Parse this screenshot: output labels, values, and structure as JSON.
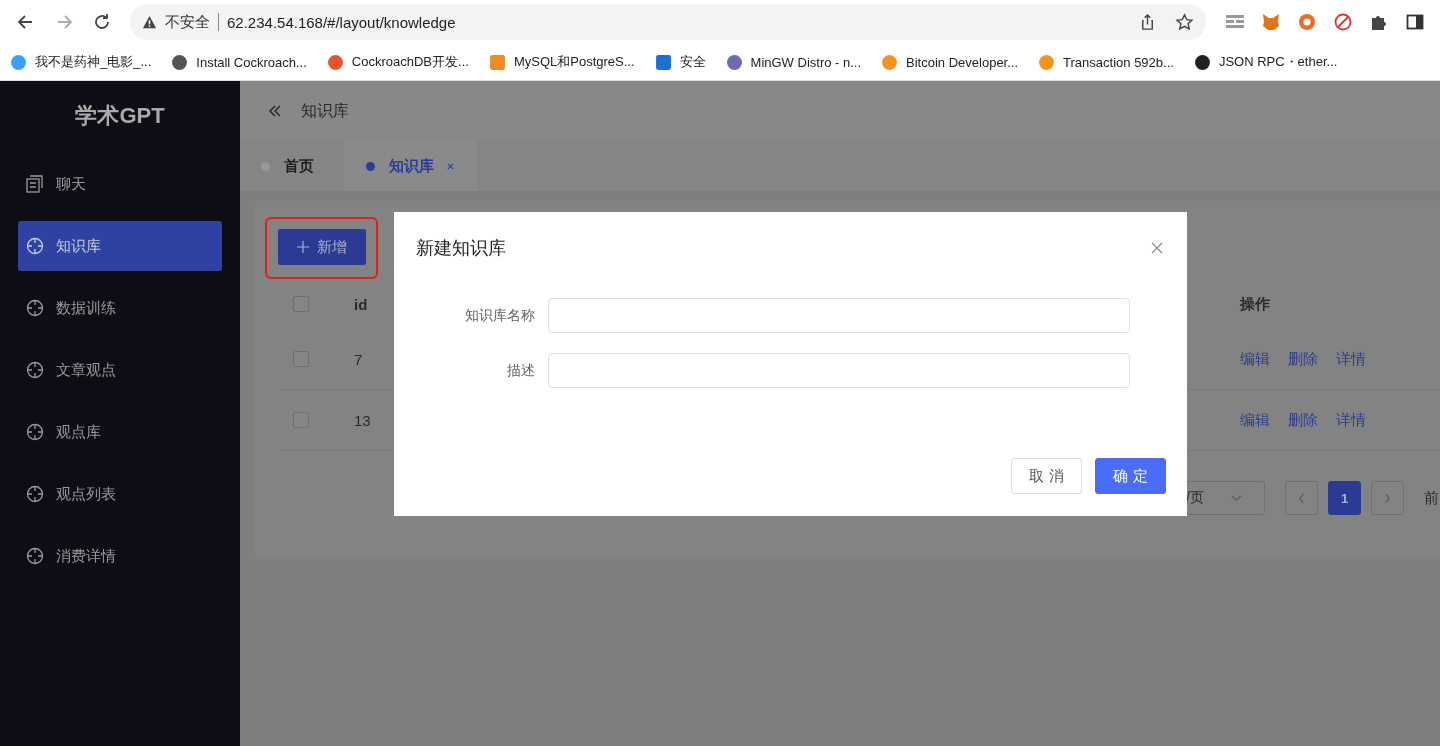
{
  "browser": {
    "security": "不安全",
    "url": "62.234.54.168/#/layout/knowledge",
    "bookmarks": [
      {
        "label": "我不是药神_电影_..."
      },
      {
        "label": "Install Cockroach..."
      },
      {
        "label": "CockroachDB开发..."
      },
      {
        "label": "MySQL和PostgreS..."
      },
      {
        "label": "安全"
      },
      {
        "label": "MinGW Distro - n..."
      },
      {
        "label": "Bitcoin Developer..."
      },
      {
        "label": "Transaction 592b..."
      },
      {
        "label": "JSON RPC・ether..."
      }
    ]
  },
  "sidebar": {
    "brand": "学术GPT",
    "items": [
      {
        "label": "聊天",
        "kind": "chat",
        "selected": false
      },
      {
        "label": "知识库",
        "kind": "section",
        "selected": true
      },
      {
        "label": "数据训练",
        "kind": "section",
        "selected": false
      },
      {
        "label": "文章观点",
        "kind": "section",
        "selected": false
      },
      {
        "label": "观点库",
        "kind": "section",
        "selected": false
      },
      {
        "label": "观点列表",
        "kind": "section",
        "selected": false
      },
      {
        "label": "消费详情",
        "kind": "section",
        "selected": false
      }
    ]
  },
  "header": {
    "breadcrumb": "知识库"
  },
  "tabs": [
    {
      "label": "首页",
      "selected": false,
      "closable": false
    },
    {
      "label": "知识库",
      "selected": true,
      "closable": true
    }
  ],
  "add_button": "新增",
  "table": {
    "columns": [
      "id",
      "操作"
    ],
    "header_checked": false,
    "rows": [
      {
        "id": "7",
        "checked": false,
        "actions": [
          "编辑",
          "删除",
          "详情"
        ]
      },
      {
        "id": "13",
        "checked": false,
        "actions": [
          "编辑",
          "删除",
          "详情"
        ]
      }
    ]
  },
  "pagination": {
    "page_size": "/页",
    "pages": [
      {
        "label": "1",
        "selected": true
      }
    ],
    "jump_label": "前"
  },
  "dialog": {
    "title": "新建知识库",
    "fields": [
      {
        "label": "知识库名称"
      },
      {
        "label": "描述"
      }
    ],
    "buttons": [
      {
        "label": "取 消",
        "kind": "secondary"
      },
      {
        "label": "确 定",
        "kind": "primary"
      }
    ]
  }
}
